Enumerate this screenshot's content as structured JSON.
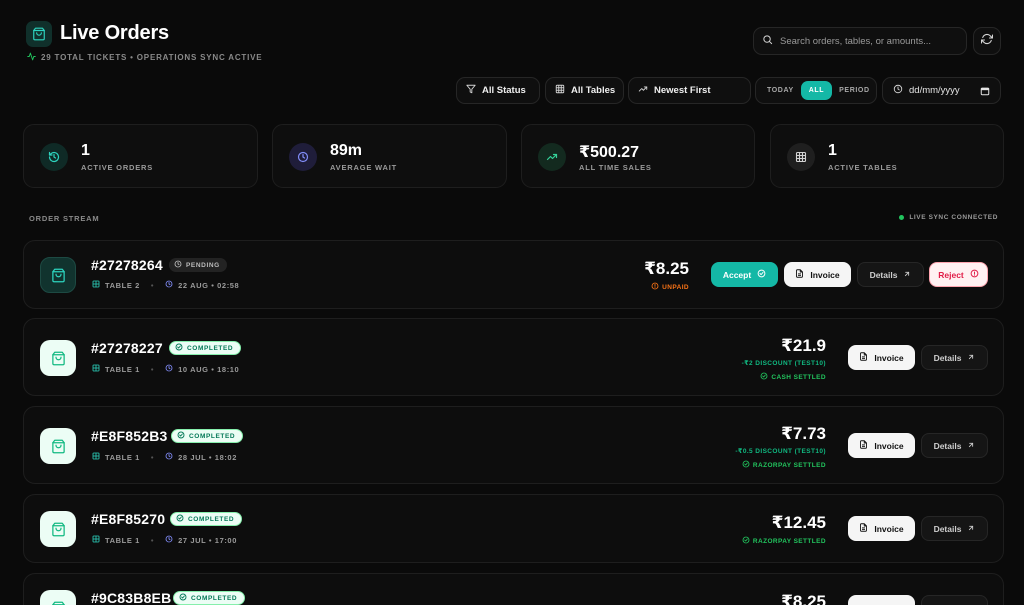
{
  "header": {
    "title": "Live Orders",
    "subtitle": "29 TOTAL TICKETS • OPERATIONS SYNC ACTIVE",
    "search_placeholder": "Search orders, tables, or amounts..."
  },
  "filters": {
    "status": "All Status",
    "tables": "All Tables",
    "sort": "Newest First",
    "period": {
      "today": "TODAY",
      "all": "ALL",
      "period": "PERIOD",
      "selected": "ALL"
    },
    "date_placeholder": "dd/mm/yyyy"
  },
  "stats": [
    {
      "value": "1",
      "label": "ACTIVE ORDERS",
      "icon": "history-icon"
    },
    {
      "value": "89m",
      "label": "AVERAGE WAIT",
      "icon": "clock-icon"
    },
    {
      "value": "₹500.27",
      "label": "ALL TIME SALES",
      "icon": "trending-up-icon"
    },
    {
      "value": "1",
      "label": "ACTIVE TABLES",
      "icon": "table-grid-icon"
    }
  ],
  "stream": {
    "label": "ORDER STREAM",
    "sync_status": "LIVE SYNC CONNECTED"
  },
  "orders": [
    {
      "id": "#27278264",
      "status": "PENDING",
      "table": "TABLE 2",
      "time": "22 AUG • 02:58",
      "price": "₹8.25",
      "note1": "UNPAID",
      "accept": "Accept",
      "invoice": "Invoice",
      "details": "Details",
      "reject": "Reject"
    },
    {
      "id": "#27278227",
      "status": "COMPLETED",
      "table": "TABLE 1",
      "time": "10 AUG • 18:10",
      "price": "₹21.9",
      "note1": "-₹2 DISCOUNT (TEST10)",
      "note2": "CASH SETTLED",
      "invoice": "Invoice",
      "details": "Details"
    },
    {
      "id": "#E8F852B3",
      "status": "COMPLETED",
      "table": "TABLE 1",
      "time": "28 JUL • 18:02",
      "price": "₹7.73",
      "note1": "-₹0.5 DISCOUNT (TEST10)",
      "note2": "RAZORPAY SETTLED",
      "invoice": "Invoice",
      "details": "Details"
    },
    {
      "id": "#E8F85270",
      "status": "COMPLETED",
      "table": "TABLE 1",
      "time": "27 JUL • 17:00",
      "price": "₹12.45",
      "note2": "RAZORPAY SETTLED",
      "invoice": "Invoice",
      "details": "Details"
    },
    {
      "id": "#9C83B8EB",
      "status": "COMPLETED",
      "price": "₹8.25"
    }
  ],
  "colors": {
    "accent": "#14b8a6",
    "background": "#0a0a0a",
    "unpaid": "#f97316",
    "settled": "#22c55e",
    "reject": "#e11d48"
  }
}
